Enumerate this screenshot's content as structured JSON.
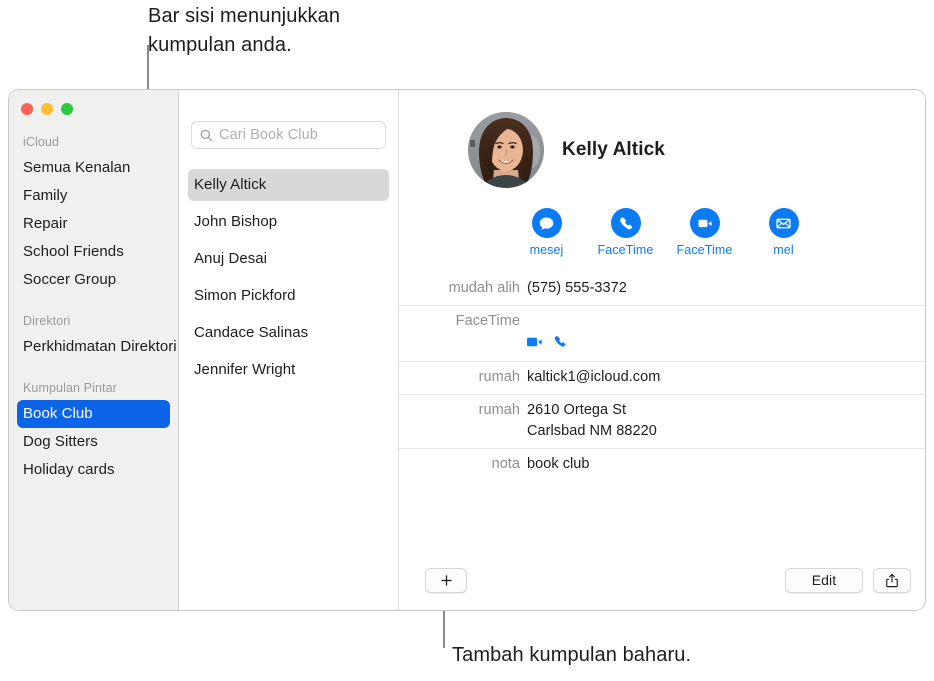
{
  "callouts": {
    "top": "Bar sisi menunjukkan\nkumpulan anda.",
    "bottom": "Tambah kumpulan baharu."
  },
  "window": {
    "traffic_lights": [
      {
        "name": "close",
        "color": "#ff6159"
      },
      {
        "name": "minimize",
        "color": "#ffbe2f"
      },
      {
        "name": "zoom",
        "color": "#2ac940"
      }
    ]
  },
  "sidebar": {
    "sections": [
      {
        "title": "iCloud",
        "items": [
          {
            "label": "Semua Kenalan",
            "selected": false
          },
          {
            "label": "Family",
            "selected": false
          },
          {
            "label": "Repair",
            "selected": false
          },
          {
            "label": "School Friends",
            "selected": false
          },
          {
            "label": "Soccer Group",
            "selected": false
          }
        ]
      },
      {
        "title": "Direktori",
        "items": [
          {
            "label": "Perkhidmatan Direktori",
            "selected": false
          }
        ]
      },
      {
        "title": "Kumpulan Pintar",
        "items": [
          {
            "label": "Book Club",
            "selected": true
          },
          {
            "label": "Dog Sitters",
            "selected": false
          },
          {
            "label": "Holiday cards",
            "selected": false
          }
        ]
      }
    ],
    "selection_color": "#0b63e5"
  },
  "list_column": {
    "search": {
      "placeholder": "Cari Book Club",
      "value": "",
      "icon": "search-icon"
    },
    "contacts": [
      {
        "name": "Kelly Altick",
        "selected": true
      },
      {
        "name": "John Bishop",
        "selected": false
      },
      {
        "name": "Anuj Desai",
        "selected": false
      },
      {
        "name": "Simon Pickford",
        "selected": false
      },
      {
        "name": "Candace Salinas",
        "selected": false
      },
      {
        "name": "Jennifer Wright",
        "selected": false
      }
    ]
  },
  "detail": {
    "avatar": "contact-photo",
    "name": "Kelly Altick",
    "accent_color": "#0b7bf5",
    "actions": [
      {
        "label": "mesej",
        "icon": "message-bubble-icon"
      },
      {
        "label": "FaceTime",
        "icon": "phone-icon"
      },
      {
        "label": "FaceTime",
        "icon": "video-camera-icon"
      },
      {
        "label": "mel",
        "icon": "envelope-icon"
      }
    ],
    "fields": [
      {
        "label": "mudah alih",
        "value": "(575) 555-3372",
        "type": "text"
      },
      {
        "label": "FaceTime",
        "value": "",
        "type": "icons",
        "icons": [
          "video-camera-icon",
          "phone-icon"
        ]
      },
      {
        "label": "rumah",
        "value": "kaltick1@icloud.com",
        "type": "text"
      },
      {
        "label": "rumah",
        "value": "2610 Ortega St\nCarlsbad NM 88220",
        "type": "text"
      },
      {
        "label": "nota",
        "value": "book club",
        "type": "text"
      }
    ]
  },
  "toolbar": {
    "add_label": "+",
    "edit_label": "Edit",
    "share_icon": "share-icon"
  }
}
